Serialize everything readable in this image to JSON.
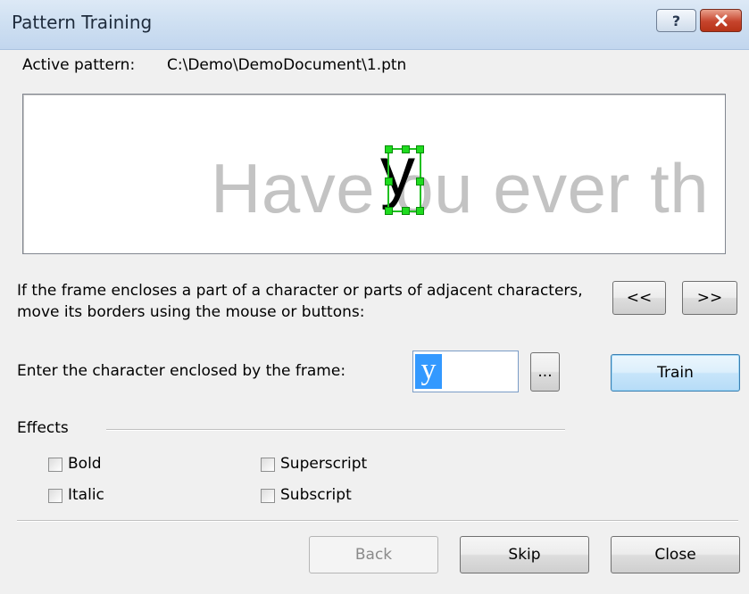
{
  "window": {
    "title": "Pattern Training",
    "help_glyph": "?",
    "close_glyph": "✕"
  },
  "active_pattern": {
    "label": "Active pattern:",
    "path": "C:\\Demo\\DemoDocument\\1.ptn"
  },
  "preview": {
    "text": "Have  ou ever th",
    "selected_char": "y"
  },
  "instructions": "If the frame encloses a part of a character or parts of adjacent characters, move its borders using the mouse or buttons:",
  "nav_buttons": {
    "prev_label": "<<",
    "next_label": ">>"
  },
  "enter": {
    "label": "Enter the character enclosed by the frame:",
    "value": "y",
    "browse_label": "...",
    "train_label": "Train"
  },
  "effects": {
    "label": "Effects",
    "options": [
      {
        "label": "Bold",
        "checked": false
      },
      {
        "label": "Italic",
        "checked": false
      },
      {
        "label": "Superscript",
        "checked": false
      },
      {
        "label": "Subscript",
        "checked": false
      }
    ]
  },
  "footer": {
    "back_label": "Back",
    "skip_label": "Skip",
    "close_label": "Close"
  }
}
